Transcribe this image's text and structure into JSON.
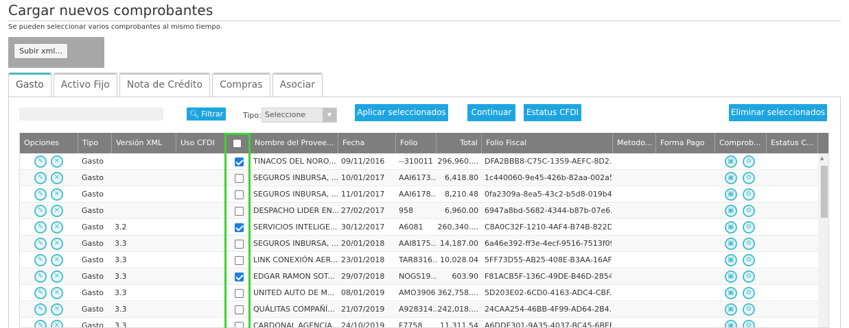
{
  "page": {
    "title": "Cargar nuevos comprobantes",
    "subtitle": "Se pueden seleccionar varios comprobantes al mismo tiempo.",
    "upload_label": "Subir xml..."
  },
  "tabs": [
    {
      "label": "Gasto",
      "active": true
    },
    {
      "label": "Activo Fijo",
      "active": false
    },
    {
      "label": "Nota de Crédito",
      "active": false
    },
    {
      "label": "Compras",
      "active": false
    },
    {
      "label": "Asociar",
      "active": false
    }
  ],
  "toolbar": {
    "filter_label": "Filtrar",
    "tipo_label": "Tipo:",
    "tipo_value": "Seleccione",
    "apply_label": "Aplicar seleccionados",
    "continue_label": "Continuar",
    "status_label": "Estatus CFDI",
    "delete_label": "Eliminar seleccionados"
  },
  "grid": {
    "columns": [
      "Opciones",
      "Tipo",
      "Versión XML",
      "Uso CFDI",
      "",
      "Nombre del Provee...",
      "Fecha",
      "Folio",
      "Total",
      "Folio Fiscal",
      "Metodo...",
      "Forma Pago",
      "Comprob...",
      "Estatus C..."
    ],
    "rows": [
      {
        "tipo": "Gasto",
        "version": "",
        "checked": true,
        "nombre": "TINACOS DEL NORO...",
        "fecha": "09/11/2016",
        "folio": "--310011",
        "total": "296,960....",
        "folio_fiscal": "DFA2BBB8-C75C-1359-AEFC-8D2..."
      },
      {
        "tipo": "Gasto",
        "version": "",
        "checked": false,
        "nombre": "SEGUROS INBURSA, ...",
        "fecha": "10/01/2017",
        "folio": "AAI6173...",
        "total": "6,418.80",
        "folio_fiscal": "1c440060-9e45-426b-82aa-002a5..."
      },
      {
        "tipo": "Gasto",
        "version": "",
        "checked": false,
        "nombre": "SEGUROS INBURSA, ...",
        "fecha": "11/01/2017",
        "folio": "AAI6178...",
        "total": "8,210.48",
        "folio_fiscal": "0fa2309a-8ea5-43c2-b5d8-019b4..."
      },
      {
        "tipo": "Gasto",
        "version": "",
        "checked": false,
        "nombre": "DESPACHO LIDER EN...",
        "fecha": "27/02/2017",
        "folio": "958",
        "total": "6,960.00",
        "folio_fiscal": "6947a8bd-5682-4344-b87b-07e6..."
      },
      {
        "tipo": "Gasto",
        "version": "3.2",
        "checked": true,
        "nombre": "SERVICIOS INTELIGE...",
        "fecha": "30/12/2017",
        "folio": "A6081",
        "total": "260,340....",
        "folio_fiscal": "C8A0C32F-1210-4AF4-B74B-822D..."
      },
      {
        "tipo": "Gasto",
        "version": "3.3",
        "checked": false,
        "nombre": "SEGUROS INBURSA, ...",
        "fecha": "20/01/2018",
        "folio": "AAI8175...",
        "total": "14,187.00",
        "folio_fiscal": "6a46e392-ff3e-4ecf-9516-7513f09..."
      },
      {
        "tipo": "Gasto",
        "version": "3.3",
        "checked": false,
        "nombre": "LINK CONEXIÓN AER...",
        "fecha": "23/01/2018",
        "folio": "TAR8316...",
        "total": "10,028.04",
        "folio_fiscal": "5FF73D55-AB25-408E-B3AA-16AF..."
      },
      {
        "tipo": "Gasto",
        "version": "3.3",
        "checked": true,
        "nombre": "EDGAR RAMON SOT...",
        "fecha": "29/07/2018",
        "folio": "NOGS19...",
        "total": "603.90",
        "folio_fiscal": "F81ACB5F-136C-49DE-B46D-2854..."
      },
      {
        "tipo": "Gasto",
        "version": "3.3",
        "checked": false,
        "nombre": "UNITED AUTO DE M...",
        "fecha": "08/01/2019",
        "folio": "AMO3906",
        "total": "362,758....",
        "folio_fiscal": "5D203E02-6CD0-4163-ADC4-CBF..."
      },
      {
        "tipo": "Gasto",
        "version": "3.3",
        "checked": false,
        "nombre": "QUÁLITAS COMPAÑÍ...",
        "fecha": "21/07/2019",
        "folio": "A928314...",
        "total": "242,018....",
        "folio_fiscal": "24CAA254-46BB-4F99-AD64-2B4..."
      },
      {
        "tipo": "Gasto",
        "version": "3.3",
        "checked": false,
        "nombre": "CARDONAL AGENCIA...",
        "fecha": "24/10/2019",
        "folio": "F7758",
        "total": "11,311.54",
        "folio_fiscal": "A6DDE301-9A35-4037-BC45-6BEE..."
      }
    ]
  }
}
